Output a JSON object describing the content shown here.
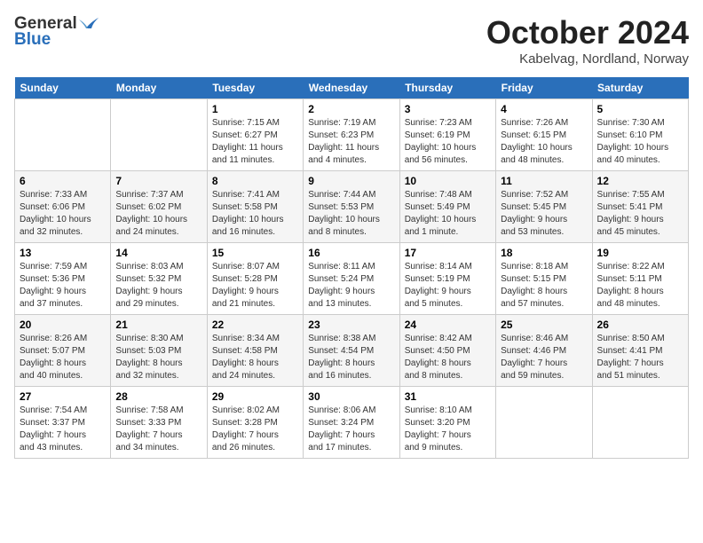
{
  "logo": {
    "general": "General",
    "blue": "Blue"
  },
  "title": "October 2024",
  "location": "Kabelvag, Nordland, Norway",
  "days_of_week": [
    "Sunday",
    "Monday",
    "Tuesday",
    "Wednesday",
    "Thursday",
    "Friday",
    "Saturday"
  ],
  "weeks": [
    [
      {
        "day": "",
        "info": ""
      },
      {
        "day": "",
        "info": ""
      },
      {
        "day": "1",
        "info": "Sunrise: 7:15 AM\nSunset: 6:27 PM\nDaylight: 11 hours\nand 11 minutes."
      },
      {
        "day": "2",
        "info": "Sunrise: 7:19 AM\nSunset: 6:23 PM\nDaylight: 11 hours\nand 4 minutes."
      },
      {
        "day": "3",
        "info": "Sunrise: 7:23 AM\nSunset: 6:19 PM\nDaylight: 10 hours\nand 56 minutes."
      },
      {
        "day": "4",
        "info": "Sunrise: 7:26 AM\nSunset: 6:15 PM\nDaylight: 10 hours\nand 48 minutes."
      },
      {
        "day": "5",
        "info": "Sunrise: 7:30 AM\nSunset: 6:10 PM\nDaylight: 10 hours\nand 40 minutes."
      }
    ],
    [
      {
        "day": "6",
        "info": "Sunrise: 7:33 AM\nSunset: 6:06 PM\nDaylight: 10 hours\nand 32 minutes."
      },
      {
        "day": "7",
        "info": "Sunrise: 7:37 AM\nSunset: 6:02 PM\nDaylight: 10 hours\nand 24 minutes."
      },
      {
        "day": "8",
        "info": "Sunrise: 7:41 AM\nSunset: 5:58 PM\nDaylight: 10 hours\nand 16 minutes."
      },
      {
        "day": "9",
        "info": "Sunrise: 7:44 AM\nSunset: 5:53 PM\nDaylight: 10 hours\nand 8 minutes."
      },
      {
        "day": "10",
        "info": "Sunrise: 7:48 AM\nSunset: 5:49 PM\nDaylight: 10 hours\nand 1 minute."
      },
      {
        "day": "11",
        "info": "Sunrise: 7:52 AM\nSunset: 5:45 PM\nDaylight: 9 hours\nand 53 minutes."
      },
      {
        "day": "12",
        "info": "Sunrise: 7:55 AM\nSunset: 5:41 PM\nDaylight: 9 hours\nand 45 minutes."
      }
    ],
    [
      {
        "day": "13",
        "info": "Sunrise: 7:59 AM\nSunset: 5:36 PM\nDaylight: 9 hours\nand 37 minutes."
      },
      {
        "day": "14",
        "info": "Sunrise: 8:03 AM\nSunset: 5:32 PM\nDaylight: 9 hours\nand 29 minutes."
      },
      {
        "day": "15",
        "info": "Sunrise: 8:07 AM\nSunset: 5:28 PM\nDaylight: 9 hours\nand 21 minutes."
      },
      {
        "day": "16",
        "info": "Sunrise: 8:11 AM\nSunset: 5:24 PM\nDaylight: 9 hours\nand 13 minutes."
      },
      {
        "day": "17",
        "info": "Sunrise: 8:14 AM\nSunset: 5:19 PM\nDaylight: 9 hours\nand 5 minutes."
      },
      {
        "day": "18",
        "info": "Sunrise: 8:18 AM\nSunset: 5:15 PM\nDaylight: 8 hours\nand 57 minutes."
      },
      {
        "day": "19",
        "info": "Sunrise: 8:22 AM\nSunset: 5:11 PM\nDaylight: 8 hours\nand 48 minutes."
      }
    ],
    [
      {
        "day": "20",
        "info": "Sunrise: 8:26 AM\nSunset: 5:07 PM\nDaylight: 8 hours\nand 40 minutes."
      },
      {
        "day": "21",
        "info": "Sunrise: 8:30 AM\nSunset: 5:03 PM\nDaylight: 8 hours\nand 32 minutes."
      },
      {
        "day": "22",
        "info": "Sunrise: 8:34 AM\nSunset: 4:58 PM\nDaylight: 8 hours\nand 24 minutes."
      },
      {
        "day": "23",
        "info": "Sunrise: 8:38 AM\nSunset: 4:54 PM\nDaylight: 8 hours\nand 16 minutes."
      },
      {
        "day": "24",
        "info": "Sunrise: 8:42 AM\nSunset: 4:50 PM\nDaylight: 8 hours\nand 8 minutes."
      },
      {
        "day": "25",
        "info": "Sunrise: 8:46 AM\nSunset: 4:46 PM\nDaylight: 7 hours\nand 59 minutes."
      },
      {
        "day": "26",
        "info": "Sunrise: 8:50 AM\nSunset: 4:41 PM\nDaylight: 7 hours\nand 51 minutes."
      }
    ],
    [
      {
        "day": "27",
        "info": "Sunrise: 7:54 AM\nSunset: 3:37 PM\nDaylight: 7 hours\nand 43 minutes."
      },
      {
        "day": "28",
        "info": "Sunrise: 7:58 AM\nSunset: 3:33 PM\nDaylight: 7 hours\nand 34 minutes."
      },
      {
        "day": "29",
        "info": "Sunrise: 8:02 AM\nSunset: 3:28 PM\nDaylight: 7 hours\nand 26 minutes."
      },
      {
        "day": "30",
        "info": "Sunrise: 8:06 AM\nSunset: 3:24 PM\nDaylight: 7 hours\nand 17 minutes."
      },
      {
        "day": "31",
        "info": "Sunrise: 8:10 AM\nSunset: 3:20 PM\nDaylight: 7 hours\nand 9 minutes."
      },
      {
        "day": "",
        "info": ""
      },
      {
        "day": "",
        "info": ""
      }
    ]
  ]
}
